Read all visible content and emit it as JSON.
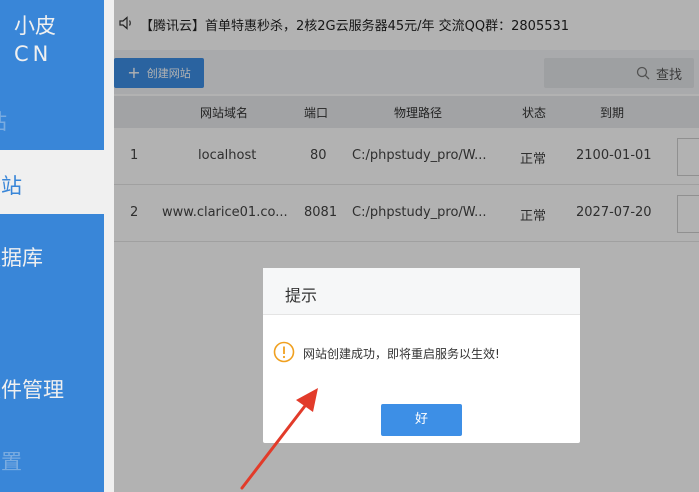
{
  "sidebar": {
    "brand_line1": "小皮",
    "brand_line2": "CN",
    "items": [
      {
        "label": "站",
        "state": "partial"
      },
      {
        "label": "网站",
        "state": "active"
      },
      {
        "label": "数据库",
        "state": "normal"
      },
      {
        "label": "软件管理",
        "state": "normal"
      },
      {
        "label": "设置",
        "state": "dim"
      }
    ]
  },
  "notice": {
    "icon": "speaker-icon",
    "text": "【腾讯云】首单特惠秒杀，2核2G云服务器45元/年 交流QQ群：2805531"
  },
  "toolbar": {
    "create_icon": "plus-icon",
    "create_label": "创建网站",
    "search_icon": "search-icon",
    "search_label": "查找"
  },
  "table": {
    "headers": [
      "网站域名",
      "端口",
      "物理路径",
      "状态",
      "到期"
    ],
    "rows": [
      {
        "index": "1",
        "domain": "localhost",
        "port": "80",
        "path": "C:/phpstudy_pro/W...",
        "status": "正常",
        "expiry": "2100-01-01"
      },
      {
        "index": "2",
        "domain": "www.clarice01.co...",
        "port": "8081",
        "path": "C:/phpstudy_pro/W...",
        "status": "正常",
        "expiry": "2027-07-20"
      }
    ]
  },
  "dialog": {
    "title": "提示",
    "icon": "warning-icon",
    "message": "网站创建成功，即将重启服务以生效!",
    "ok_label": "好"
  },
  "colors": {
    "accent": "#3d8fe6",
    "warning": "#f0a020",
    "annotation_arrow": "#e23b2a"
  }
}
